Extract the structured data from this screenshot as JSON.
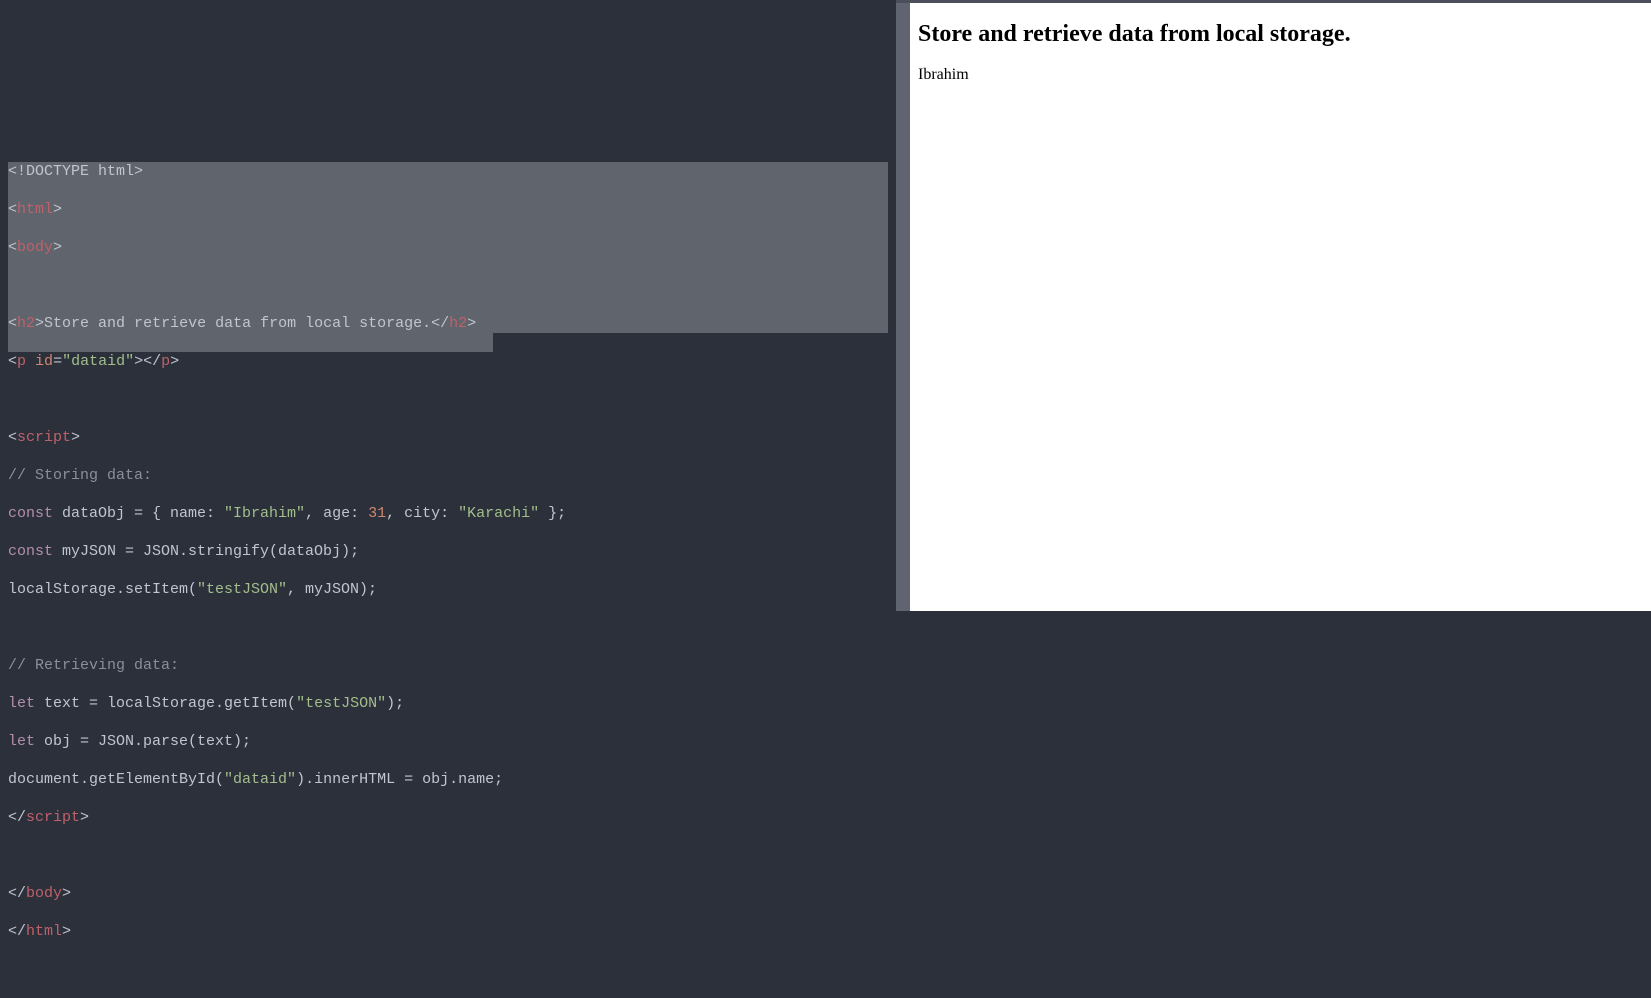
{
  "code": {
    "l1_doctype": "<!DOCTYPE html>",
    "l2_open_html_a": "<",
    "l2_open_html_b": "html",
    "l2_open_html_c": ">",
    "l3_open_body_a": "<",
    "l3_open_body_b": "body",
    "l3_open_body_c": ">",
    "l5_a": "<",
    "l5_tag": "h2",
    "l5_b": ">",
    "l5_text": "Store and retrieve data from local storage.",
    "l5_c": "</",
    "l5_d": ">",
    "l6_a": "<",
    "l6_tag": "p",
    "l6_sp": " ",
    "l6_attr": "id",
    "l6_eq": "=",
    "l6_val": "\"dataid\"",
    "l6_b": "></",
    "l6_c": ">",
    "l8_a": "<",
    "l8_tag": "script",
    "l8_b": ">",
    "l9_comment": "// Storing data:",
    "l10_kw": "const",
    "l10_rest_a": " dataObj = { name: ",
    "l10_str1": "\"Ibrahim\"",
    "l10_rest_b": ", age: ",
    "l10_num": "31",
    "l10_rest_c": ", city: ",
    "l10_str2": "\"Karachi\"",
    "l10_rest_d": " };",
    "l11_kw": "const",
    "l11_rest": " myJSON = JSON.stringify(dataObj);",
    "l12_a": "localStorage.setItem(",
    "l12_str": "\"testJSON\"",
    "l12_b": ", myJSON);",
    "l14_comment": "// Retrieving data:",
    "l15_kw": "let",
    "l15_a": " text = localStorage.getItem(",
    "l15_str": "\"testJSON\"",
    "l15_b": ");",
    "l16_kw": "let",
    "l16_rest": " obj = JSON.parse(text);",
    "l17_a": "document.getElementById(",
    "l17_str": "\"dataid\"",
    "l17_b": ").innerHTML = obj.name;",
    "l18_a": "</",
    "l18_tag": "script",
    "l18_b": ">",
    "l20_a": "</",
    "l20_tag": "body",
    "l20_b": ">",
    "l21_a": "</",
    "l21_tag": "html",
    "l21_b": ">"
  },
  "preview": {
    "heading": "Store and retrieve data from local storage.",
    "output": "Ibrahim"
  }
}
